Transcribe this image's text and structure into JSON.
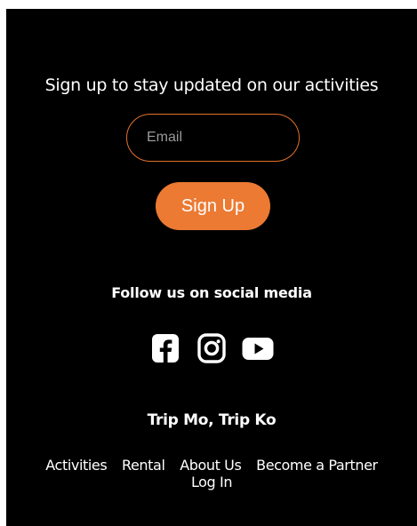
{
  "newsletter": {
    "title": "Sign up to stay updated on our activities",
    "email_placeholder": "Email",
    "email_value": "",
    "button_label": "Sign Up"
  },
  "social": {
    "title": "Follow us on social media",
    "icons": [
      "facebook-icon",
      "instagram-icon",
      "youtube-icon"
    ]
  },
  "brand": {
    "name": "Trip Mo, Trip Ko"
  },
  "nav": {
    "links": [
      "Activities",
      "Rental",
      "About Us",
      "Become a Partner",
      "Log In"
    ]
  },
  "colors": {
    "background": "#000000",
    "text": "#ffffff",
    "accent": "#ec7a33",
    "input_border": "#e2712a"
  }
}
